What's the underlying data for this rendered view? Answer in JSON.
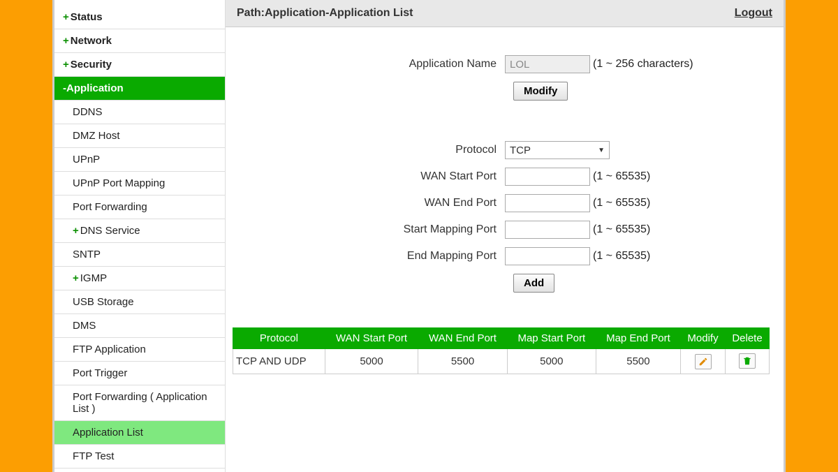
{
  "sidebar": {
    "top": [
      {
        "label": "Status",
        "expandable": true
      },
      {
        "label": "Network",
        "expandable": true
      },
      {
        "label": "Security",
        "expandable": true
      }
    ],
    "activeSection": "Application",
    "sub": [
      {
        "label": "DDNS"
      },
      {
        "label": "DMZ Host"
      },
      {
        "label": "UPnP"
      },
      {
        "label": "UPnP Port Mapping"
      },
      {
        "label": "Port Forwarding"
      },
      {
        "label": "DNS Service",
        "expandable": true
      },
      {
        "label": "SNTP"
      },
      {
        "label": "IGMP",
        "expandable": true
      },
      {
        "label": "USB Storage"
      },
      {
        "label": "DMS"
      },
      {
        "label": "FTP Application"
      },
      {
        "label": "Port Trigger"
      },
      {
        "label": "Port Forwarding ( Application List )"
      },
      {
        "label": "Application List",
        "selected": true
      },
      {
        "label": "FTP Test"
      }
    ]
  },
  "header": {
    "path": "Path:Application-Application List",
    "logout": "Logout"
  },
  "form": {
    "appName": {
      "label": "Application Name",
      "value": "LOL",
      "hint": "(1 ~ 256 characters)"
    },
    "modifyBtn": "Modify",
    "protocol": {
      "label": "Protocol",
      "value": "TCP"
    },
    "wanStart": {
      "label": "WAN Start Port",
      "value": "",
      "hint": "(1 ~ 65535)"
    },
    "wanEnd": {
      "label": "WAN End Port",
      "value": "",
      "hint": "(1 ~ 65535)"
    },
    "mapStart": {
      "label": "Start Mapping Port",
      "value": "",
      "hint": "(1 ~ 65535)"
    },
    "mapEnd": {
      "label": "End Mapping Port",
      "value": "",
      "hint": "(1 ~ 65535)"
    },
    "addBtn": "Add"
  },
  "table": {
    "headers": {
      "protocol": "Protocol",
      "wanStart": "WAN Start Port",
      "wanEnd": "WAN End Port",
      "mapStart": "Map Start Port",
      "mapEnd": "Map End Port",
      "modify": "Modify",
      "delete": "Delete"
    },
    "rows": [
      {
        "protocol": "TCP AND UDP",
        "wanStart": "5000",
        "wanEnd": "5500",
        "mapStart": "5000",
        "mapEnd": "5500"
      }
    ]
  }
}
